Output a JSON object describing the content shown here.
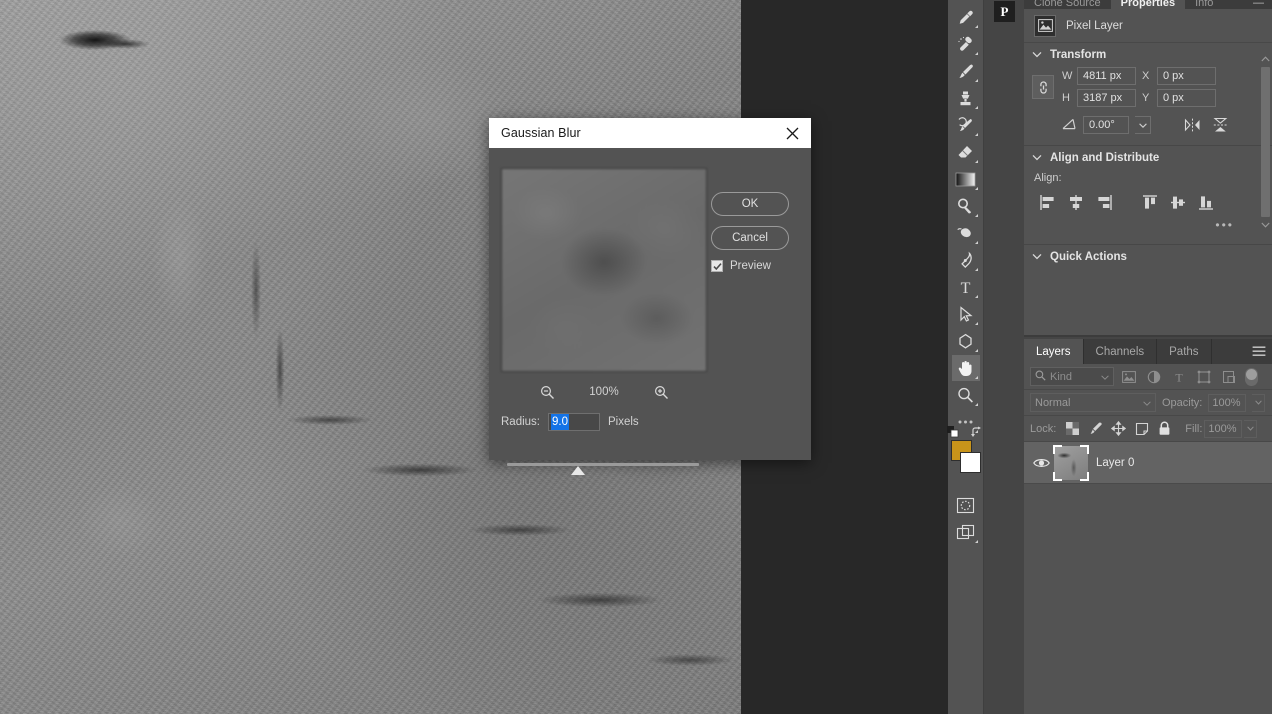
{
  "app": {
    "logo": "P"
  },
  "canvas": {
    "name": "image-canvas",
    "description": "grayscale stone texture"
  },
  "dialog": {
    "title": "Gaussian Blur",
    "close_icon": "close-icon",
    "preview_zoom": "100%",
    "zoom_out_icon": "zoom-out-icon",
    "zoom_in_icon": "zoom-in-icon",
    "radius_label": "Radius:",
    "radius_value": "9.0",
    "radius_units": "Pixels",
    "ok_label": "OK",
    "cancel_label": "Cancel",
    "preview_label": "Preview",
    "preview_checked": true
  },
  "toolbar": {
    "tools": [
      {
        "name": "eyedropper-tool",
        "selected": false
      },
      {
        "name": "spot-healing-brush-tool",
        "selected": false
      },
      {
        "name": "brush-tool",
        "selected": false
      },
      {
        "name": "clone-stamp-tool",
        "selected": false
      },
      {
        "name": "history-brush-tool",
        "selected": false
      },
      {
        "name": "eraser-tool",
        "selected": false
      },
      {
        "name": "gradient-tool",
        "selected": false
      },
      {
        "name": "dodge-tool",
        "selected": false
      },
      {
        "name": "blur-tool",
        "selected": false
      },
      {
        "name": "pen-tool",
        "selected": false
      },
      {
        "name": "type-tool",
        "selected": false
      },
      {
        "name": "path-selection-tool",
        "selected": false
      },
      {
        "name": "polygon-shape-tool",
        "selected": false
      },
      {
        "name": "hand-tool",
        "selected": true
      },
      {
        "name": "zoom-tool",
        "selected": false
      },
      {
        "name": "edit-toolbar-tool",
        "selected": false
      }
    ],
    "foreground_color": "#c8941a",
    "background_color": "#ffffff",
    "quick_mask_icon": "quick-mask-icon",
    "screen_mode_icon": "screen-mode-icon"
  },
  "properties_panel": {
    "tabs": [
      {
        "label": "Clone Source",
        "active": false
      },
      {
        "label": "Properties",
        "active": true
      },
      {
        "label": "Info",
        "active": false
      }
    ],
    "collapse_icon": "collapse-icon",
    "layer_type": "Pixel Layer",
    "layer_type_icon": "image-layer-icon",
    "transform": {
      "title": "Transform",
      "link_icon": "link-aspect-ratio-icon",
      "w_label": "W",
      "w_value": "4811 px",
      "h_label": "H",
      "h_value": "3187 px",
      "x_label": "X",
      "x_value": "0 px",
      "y_label": "Y",
      "y_value": "0 px",
      "angle_icon": "angle-icon",
      "angle_value": "0.00°",
      "flip_horizontal_icon": "flip-horizontal-icon",
      "flip_vertical_icon": "flip-vertical-icon"
    },
    "align": {
      "title": "Align and Distribute",
      "align_label": "Align:",
      "buttons": [
        "align-left-edges-icon",
        "align-horizontal-centers-icon",
        "align-right-edges-icon",
        "align-top-edges-icon",
        "align-vertical-centers-icon",
        "align-bottom-edges-icon"
      ],
      "more_label": "•••"
    },
    "quick_actions": {
      "title": "Quick Actions"
    }
  },
  "layers_panel": {
    "tabs": [
      {
        "label": "Layers",
        "active": true
      },
      {
        "label": "Channels",
        "active": false
      },
      {
        "label": "Paths",
        "active": false
      }
    ],
    "menu_icon": "panel-menu-icon",
    "filter": {
      "search_icon": "search-icon",
      "kind_label": "Kind",
      "icons": [
        "filter-pixel-icon",
        "filter-adjustment-icon",
        "filter-type-icon",
        "filter-shape-icon",
        "filter-smart-object-icon"
      ],
      "toggle_name": "filter-toggle"
    },
    "blend_mode": "Normal",
    "opacity_label": "Opacity:",
    "opacity_value": "100%",
    "lock_label": "Lock:",
    "lock_icons": [
      "lock-transparent-pixels-icon",
      "lock-image-pixels-icon",
      "lock-position-icon",
      "lock-artboard-nesting-icon",
      "lock-all-icon"
    ],
    "fill_label": "Fill:",
    "fill_value": "100%",
    "layers": [
      {
        "name": "Layer 0",
        "visible": true,
        "selected": true
      }
    ]
  }
}
